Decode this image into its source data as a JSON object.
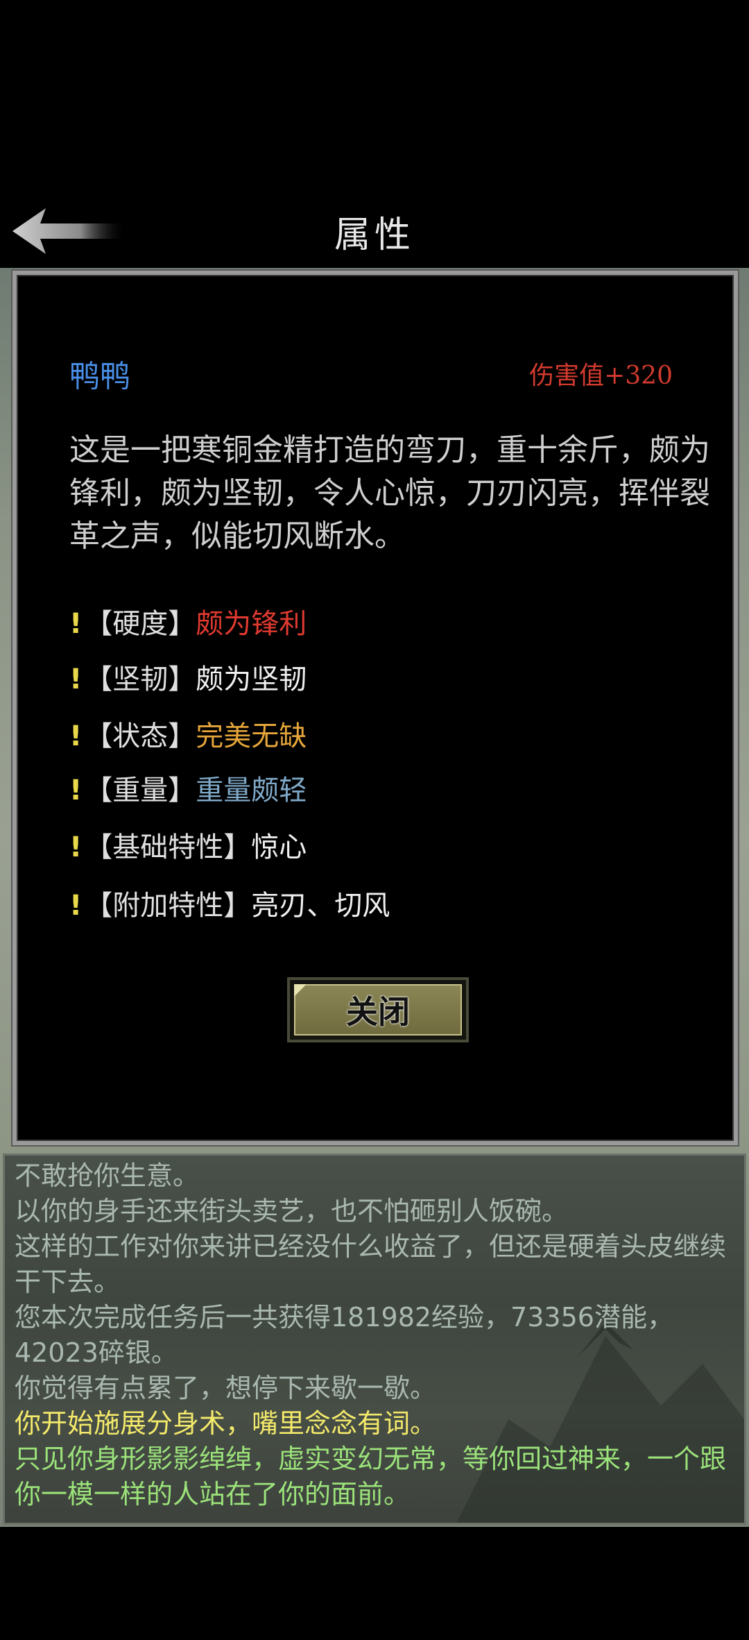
{
  "header": {
    "title": "属性",
    "back_icon": "back-arrow-icon"
  },
  "item": {
    "name": "鸭鸭",
    "damage": "伤害值+320",
    "description": "这是一把寒铜金精打造的弯刀，重十余斤，颇为锋利，颇为坚韧，令人心惊，刀刃闪亮，挥伴裂革之声，似能切风断水。",
    "attributes": [
      {
        "mark": "!",
        "key": "【硬度】",
        "value": "颇为锋利",
        "color": "#e03a30"
      },
      {
        "mark": "!",
        "key": "【坚韧】",
        "value": "颇为坚韧",
        "color": "#f0f0f0"
      },
      {
        "mark": "!",
        "key": "【状态】",
        "value": "完美无缺",
        "color": "#e5a53a"
      },
      {
        "mark": "!",
        "key": "【重量】",
        "value": "重量颇轻",
        "color": "#7fa9c8"
      },
      {
        "mark": "!",
        "key": "【基础特性】",
        "value": "惊心",
        "color": "#f0f0f0"
      },
      {
        "mark": "!",
        "key": "【附加特性】",
        "value": "亮刃、切风",
        "color": "#f0f0f0"
      }
    ],
    "close_label": "关闭"
  },
  "log": [
    {
      "text": "不敢抢你生意。",
      "color": "#a9b8b0"
    },
    {
      "text": "以你的身手还来街头卖艺，也不怕砸别人饭碗。",
      "color": "#a9b8b0"
    },
    {
      "text": "这样的工作对你来讲已经没什么收益了，但还是硬着头皮继续干下去。",
      "color": "#a9b8b0"
    },
    {
      "text": "您本次完成任务后一共获得181982经验，73356潜能，42023碎银。",
      "color": "#a9b8b0"
    },
    {
      "text": "你觉得有点累了，想停下来歇一歇。",
      "color": "#a9b8b0"
    },
    {
      "text": "你开始施展分身术，嘴里念念有词。",
      "color": "#f3e96a"
    },
    {
      "text": "只见你身形影影绰绰，虚实变幻无常，等你回过神来，一个跟你一模一样的人站在了你的面前。",
      "color": "#9be27a"
    }
  ]
}
